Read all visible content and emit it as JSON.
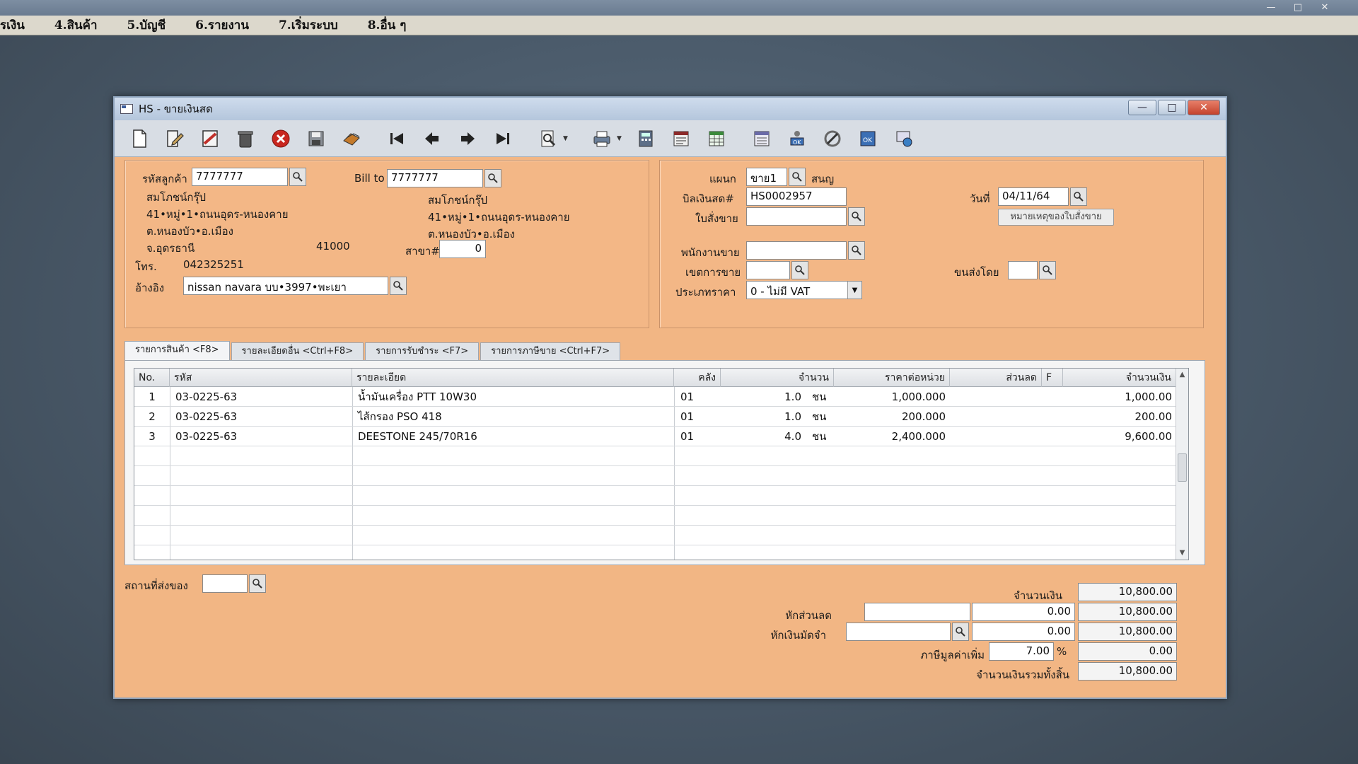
{
  "menubar": {
    "items": [
      "รเงิน",
      "4.สินค้า",
      "5.บัญชี",
      "6.รายงาน",
      "7.เริ่มระบบ",
      "8.อื่น ๆ"
    ]
  },
  "window": {
    "title": "HS - ขายเงินสด"
  },
  "customer": {
    "code_label": "รหัสลูกค้า",
    "code": "7777777",
    "name": "สมโภชน์กรุ๊ป",
    "address1": "41•หมู่•1•ถนนอุดร-หนองคาย",
    "address2": "ต.หนองบัว•อ.เมือง",
    "address3": "จ.อุดรธานี",
    "postcode": "41000",
    "phone_label": "โทร.",
    "phone": "042325251",
    "ref_label": "อ้างอิง",
    "ref": "nissan navara บบ•3997•พะเยา"
  },
  "bill_to": {
    "label": "Bill to",
    "code": "7777777",
    "name": "สมโภชน์กรุ๊ป",
    "address1": "41•หมู่•1•ถนนอุดร-หนองคาย",
    "address2": "ต.หนองบัว•อ.เมือง",
    "branch_label": "สาขา#",
    "branch": "0"
  },
  "doc": {
    "dept_label": "แผนก",
    "dept": "ขาย1",
    "dept_name": "สนญ",
    "bill_label": "บิลเงินสด#",
    "bill_no": "HS0002957",
    "order_label": "ใบสั่งขาย",
    "order": "",
    "date_label": "วันที่",
    "date": "04/11/64",
    "note_btn": "หมายเหตุของใบสั่งขาย",
    "sales_label": "พนักงานขาย",
    "sales": "",
    "area_label": "เขตการขาย",
    "area": "",
    "ship_by_label": "ขนส่งโดย",
    "ship_by": "",
    "price_type_label": "ประเภทราคา",
    "price_type": "0 - ไม่มี VAT"
  },
  "tabs": [
    {
      "label": "รายการสินค้า <F8>",
      "active": true
    },
    {
      "label": "รายละเอียดอื่น <Ctrl+F8>",
      "active": false
    },
    {
      "label": "รายการรับชำระ <F7>",
      "active": false
    },
    {
      "label": "รายการภาษีขาย <Ctrl+F7>",
      "active": false
    }
  ],
  "grid": {
    "headers": {
      "no": "No.",
      "code": "รหัส",
      "desc": "รายละเอียด",
      "wh": "คลัง",
      "qty": "จำนวน",
      "price": "ราคาต่อหน่วย",
      "discount": "ส่วนลด",
      "f": "F",
      "amount": "จำนวนเงิน"
    },
    "rows": [
      {
        "no": "1",
        "code": "03-0225-63",
        "desc": "น้ำมันเครื่อง PTT 10W30",
        "wh": "01",
        "qty": "1.0",
        "unit": "ชน",
        "price": "1,000.000",
        "discount": "",
        "amount": "1,000.00"
      },
      {
        "no": "2",
        "code": "03-0225-63",
        "desc": "ไส้กรอง PSO 418",
        "wh": "01",
        "qty": "1.0",
        "unit": "ชน",
        "price": "200.000",
        "discount": "",
        "amount": "200.00"
      },
      {
        "no": "3",
        "code": "03-0225-63",
        "desc": "DEESTONE 245/70R16",
        "wh": "01",
        "qty": "4.0",
        "unit": "ชน",
        "price": "2,400.000",
        "discount": "",
        "amount": "9,600.00"
      }
    ]
  },
  "footer": {
    "ship_place_label": "สถานที่ส่งของ",
    "ship_place": "",
    "amount_label": "จำนวนเงิน",
    "amount": "10,800.00",
    "discount_label": "หักส่วนลด",
    "discount_text": "",
    "discount_value": "0.00",
    "after_discount": "10,800.00",
    "deposit_label": "หักเงินมัดจำ",
    "deposit_text": "",
    "deposit_value": "0.00",
    "after_deposit": "10,800.00",
    "vat_label": "ภาษีมูลค่าเพิ่ม",
    "vat_rate": "7.00",
    "vat_pct": "%",
    "vat_amount": "0.00",
    "total_label": "จำนวนเงินรวมทั้งสิ้น",
    "total": "10,800.00"
  },
  "colors": {
    "panel": "#f3b786",
    "window_border": "#8fa4bd",
    "toolbar": "#d8dde4"
  }
}
